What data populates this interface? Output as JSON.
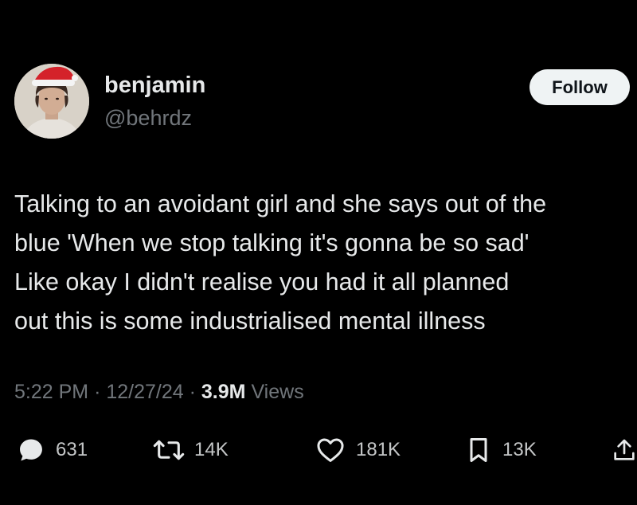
{
  "author": {
    "name": "benjamin",
    "handle": "@behrdz"
  },
  "follow_label": "Follow",
  "tweet": {
    "lines": [
      "Talking to an avoidant girl and she says out of the",
      "blue 'When we stop talking it's gonna be so sad'",
      "Like okay I didn't realise you had it all planned",
      "out this is some industrialised mental illness"
    ]
  },
  "meta": {
    "time": "5:22 PM",
    "date": "12/27/24",
    "separator": "·",
    "views_count": "3.9M",
    "views_label": "Views"
  },
  "actions": {
    "replies": {
      "icon": "reply-icon",
      "count": "631"
    },
    "reposts": {
      "icon": "repost-icon",
      "count": "14K"
    },
    "likes": {
      "icon": "heart-icon",
      "count": "181K"
    },
    "bookmarks": {
      "icon": "bookmark-icon",
      "count": "13K"
    },
    "share": {
      "icon": "share-icon"
    }
  },
  "colors": {
    "background": "#000000",
    "text_primary": "#e7e9ea",
    "text_secondary": "#71767b",
    "follow_button_bg": "#eff3f4",
    "follow_button_text": "#0f1419",
    "avatar_hat": "#d4222a"
  }
}
